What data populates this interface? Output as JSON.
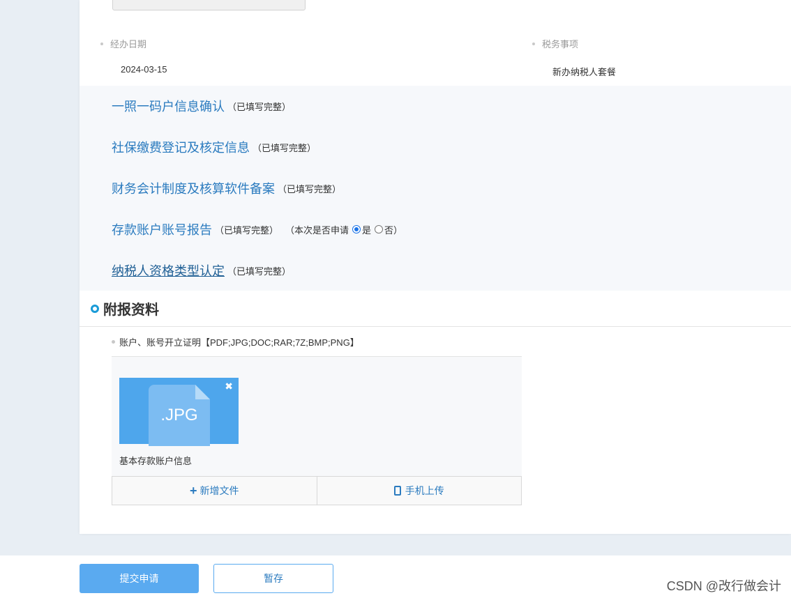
{
  "fields": {
    "date_label": "经办日期",
    "date_value": "2024-03-15",
    "tax_label": "税务事项",
    "tax_value": "新办纳税人套餐"
  },
  "steps": [
    {
      "title": "一照一码户信息确认",
      "status": "（已填写完整）"
    },
    {
      "title": "社保缴费登记及核定信息",
      "status": "（已填写完整）"
    },
    {
      "title": "财务会计制度及核算软件备案",
      "status": "（已填写完整）"
    },
    {
      "title": "存款账户账号报告",
      "status": "（已填写完整）",
      "question": "（本次是否申请",
      "option_yes": "是",
      "option_no": "否）",
      "selected": "yes"
    },
    {
      "title": "纳税人资格类型认定",
      "status": "（已填写完整）"
    }
  ],
  "attachments": {
    "section_title": "附报资料",
    "item_label": "账户、账号开立证明【PDF;JPG;DOC;RAR;7Z;BMP;PNG】",
    "file": {
      "ext": ".JPG",
      "name": "基本存款账户信息",
      "close": "✖"
    },
    "add_file_label": "新增文件",
    "add_file_icon": "+",
    "mobile_upload_label": "手机上传"
  },
  "footer": {
    "submit_label": "提交申请",
    "save_label": "暂存",
    "watermark": "CSDN @改行做会计"
  },
  "colors": {
    "link": "#2b7bbf",
    "primary": "#5aaaf0",
    "file_tile": "#4ea6ec",
    "section_ring": "#1a9bd7"
  }
}
